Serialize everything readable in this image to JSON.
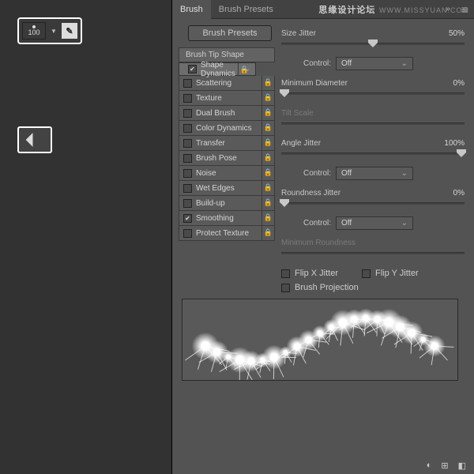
{
  "watermark": {
    "cn": "思缘设计论坛",
    "url": "WWW.MISSYUAN.COM"
  },
  "brushSize": "100",
  "tabs": {
    "brush": "Brush",
    "presets": "Brush Presets"
  },
  "presetBtn": "Brush Presets",
  "tip": "Brush Tip Shape",
  "items": [
    {
      "label": "Shape Dynamics",
      "chk": true,
      "sel": true,
      "lock": true
    },
    {
      "label": "Scattering",
      "chk": false,
      "lock": true
    },
    {
      "label": "Texture",
      "chk": false,
      "lock": true
    },
    {
      "label": "Dual Brush",
      "chk": false,
      "lock": true
    },
    {
      "label": "Color Dynamics",
      "chk": false,
      "lock": true
    },
    {
      "label": "Transfer",
      "chk": false,
      "lock": true
    },
    {
      "label": "Brush Pose",
      "chk": false,
      "lock": true
    },
    {
      "label": "Noise",
      "chk": false,
      "lock": true
    },
    {
      "label": "Wet Edges",
      "chk": false,
      "lock": true
    },
    {
      "label": "Build-up",
      "chk": false,
      "lock": true
    },
    {
      "label": "Smoothing",
      "chk": true,
      "lock": true
    },
    {
      "label": "Protect Texture",
      "chk": false,
      "lock": true
    }
  ],
  "r": {
    "sizeJitter": {
      "l": "Size Jitter",
      "v": "50%",
      "p": 50
    },
    "ctrl1": {
      "l": "Control:",
      "v": "Off"
    },
    "minDia": {
      "l": "Minimum Diameter",
      "v": "0%",
      "p": 0
    },
    "tilt": {
      "l": "Tilt Scale",
      "dim": true
    },
    "angle": {
      "l": "Angle Jitter",
      "v": "100%",
      "p": 100
    },
    "ctrl2": {
      "l": "Control:",
      "v": "Off"
    },
    "round": {
      "l": "Roundness Jitter",
      "v": "0%",
      "p": 0
    },
    "ctrl3": {
      "l": "Control:",
      "v": "Off"
    },
    "minRound": {
      "l": "Minimum Roundness",
      "dim": true
    },
    "flipX": "Flip X Jitter",
    "flipY": "Flip Y Jitter",
    "proj": "Brush Projection"
  }
}
